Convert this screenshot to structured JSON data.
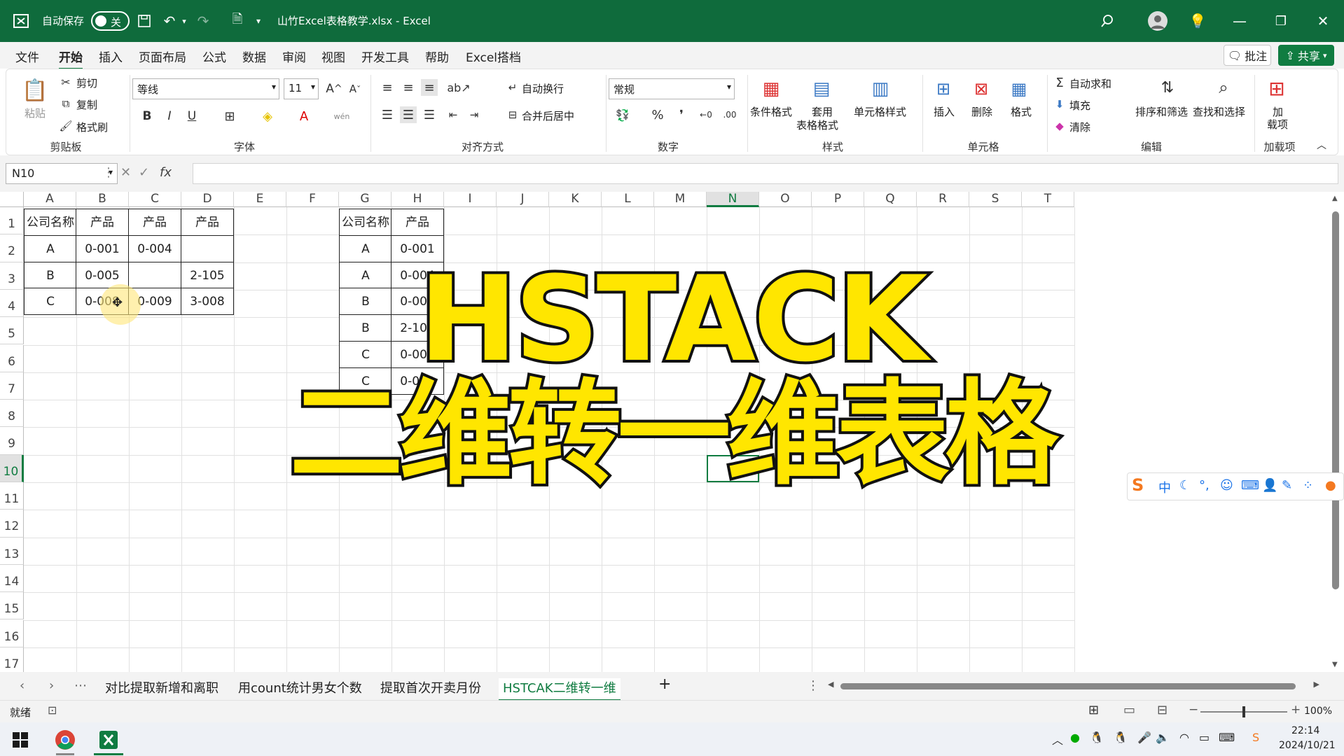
{
  "titlebar": {
    "autosave_label": "自动保存",
    "autosave_state": "关",
    "filename": "山竹Excel表格教学.xlsx - Excel"
  },
  "menu": {
    "tabs": [
      "文件",
      "开始",
      "插入",
      "页面布局",
      "公式",
      "数据",
      "审阅",
      "视图",
      "开发工具",
      "帮助",
      "Excel搭档"
    ],
    "active_tab": "开始",
    "comment_button": "批注",
    "share_button": "共享"
  },
  "ribbon": {
    "clipboard": {
      "paste": "粘贴",
      "cut": "剪切",
      "copy": "复制",
      "format_painter": "格式刷",
      "group": "剪贴板"
    },
    "font": {
      "name": "等线",
      "size": "11",
      "group": "字体",
      "bold": "B",
      "italic": "I",
      "underline": "U"
    },
    "alignment": {
      "wrap": "自动换行",
      "merge": "合并后居中",
      "group": "对齐方式"
    },
    "number": {
      "format": "常规",
      "group": "数字"
    },
    "styles": {
      "conditional": "条件格式",
      "table_l1": "套用",
      "table_l2": "表格格式",
      "cell_styles": "单元格样式",
      "group": "样式"
    },
    "cells": {
      "insert": "插入",
      "delete": "删除",
      "format": "格式",
      "group": "单元格"
    },
    "editing": {
      "autosum": "自动求和",
      "fill": "填充",
      "clear": "清除",
      "sort": "排序和筛选",
      "find": "查找和选择",
      "group": "编辑"
    },
    "addins": {
      "l1": "加",
      "l2": "载项",
      "group": "加载项"
    }
  },
  "formula_bar": {
    "namebox": "N10",
    "fx": "fx",
    "value": ""
  },
  "columns": [
    "A",
    "B",
    "C",
    "D",
    "E",
    "F",
    "G",
    "H",
    "I",
    "J",
    "K",
    "L",
    "M",
    "N",
    "O",
    "P",
    "Q",
    "R",
    "S",
    "T"
  ],
  "selected_column": "N",
  "rows": [
    "1",
    "2",
    "3",
    "4",
    "5",
    "6",
    "7",
    "8",
    "9",
    "10",
    "11",
    "12",
    "13",
    "14",
    "15",
    "16",
    "17"
  ],
  "selected_row": "10",
  "table1": [
    [
      "公司名称",
      "产品",
      "产品",
      "产品"
    ],
    [
      "A",
      "0-001",
      "0-004",
      ""
    ],
    [
      "B",
      "0-005",
      "",
      "2-105"
    ],
    [
      "C",
      "0-008",
      "0-009",
      "3-008"
    ]
  ],
  "table2": [
    [
      "公司名称",
      "产品"
    ],
    [
      "A",
      "0-001"
    ],
    [
      "A",
      "0-004"
    ],
    [
      "B",
      "0-005"
    ],
    [
      "B",
      "2-105"
    ],
    [
      "C",
      "0-008"
    ],
    [
      "C",
      "0-009"
    ]
  ],
  "overlay": {
    "line1": "HSTACK",
    "line2": "二维转一维表格"
  },
  "ime": {
    "lang": "中"
  },
  "sheet_tabs": [
    "对比提取新增和离职",
    "用count统计男女个数",
    "提取首次开卖月份",
    "HSTCAK二维转一维"
  ],
  "active_sheet": "HSTCAK二维转一维",
  "status": {
    "ready": "就绪",
    "zoom": "100%"
  },
  "taskbar": {
    "time": "22:14",
    "date": "2024/10/21"
  },
  "colors": {
    "excel_green": "#0f6b3c",
    "accent": "#107c41",
    "overlay_yellow": "#ffe600"
  }
}
